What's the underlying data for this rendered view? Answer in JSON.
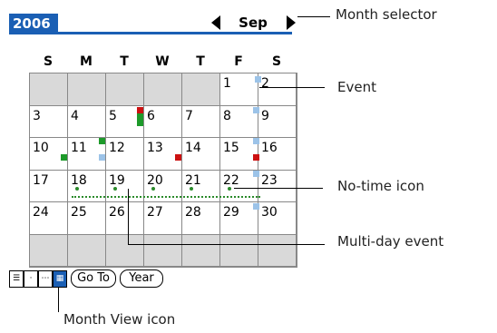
{
  "header": {
    "year": "2006",
    "month": "Sep"
  },
  "weekdays": [
    "S",
    "M",
    "T",
    "W",
    "T",
    "F",
    "S"
  ],
  "weeks": [
    [
      "",
      "",
      "",
      "",
      "",
      "1",
      "2"
    ],
    [
      "3",
      "4",
      "5",
      "6",
      "7",
      "8",
      "9"
    ],
    [
      "10",
      "11",
      "12",
      "13",
      "14",
      "15",
      "16"
    ],
    [
      "17",
      "18",
      "19",
      "20",
      "21",
      "22",
      "23"
    ],
    [
      "24",
      "25",
      "26",
      "27",
      "28",
      "29",
      "30"
    ],
    [
      "",
      "",
      "",
      "",
      "",
      "",
      ""
    ]
  ],
  "toolbar": {
    "goto_label": "Go To",
    "year_label": "Year"
  },
  "callouts": {
    "month_selector": "Month selector",
    "event": "Event",
    "no_time_icon": "No-time icon",
    "multi_day_event": "Multi-day event",
    "month_view_icon": "Month View icon"
  },
  "colors": {
    "accent": "#1a5fb4",
    "event_blue": "#9cc3e8",
    "event_red": "#cc1111",
    "event_green": "#1d9a2a",
    "empty_cell": "#d9d9d9"
  },
  "icons": {
    "prev": "triangle-left-icon",
    "next": "triangle-right-icon",
    "view_list": "list-view-icon",
    "view_day": "day-view-icon",
    "view_week": "week-view-icon",
    "view_month": "month-view-icon"
  }
}
